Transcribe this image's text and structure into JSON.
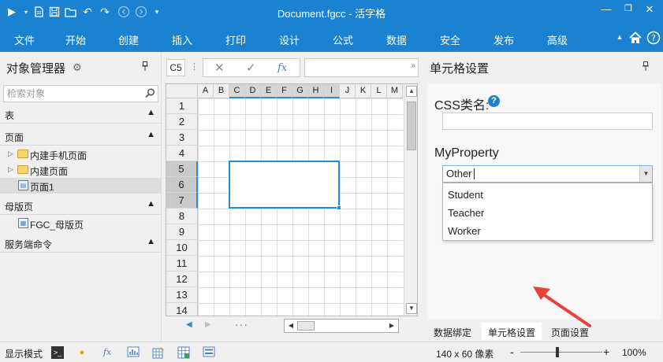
{
  "titlebar": {
    "title": "Document.fgcc - 活字格",
    "quick_access": [
      "play-icon",
      "dropdown-icon",
      "new-doc-icon",
      "save-icon",
      "open-folder-icon",
      "undo-icon",
      "redo-icon",
      "back-icon",
      "forward-icon",
      "customize-icon"
    ],
    "window_buttons": [
      "minimize-icon",
      "restore-icon",
      "close-icon"
    ]
  },
  "menubar": {
    "items": [
      "文件",
      "开始",
      "创建",
      "插入",
      "打印",
      "设计",
      "公式",
      "数据",
      "安全",
      "发布",
      "高级"
    ],
    "active": "开始"
  },
  "object_manager": {
    "title": "对象管理器",
    "search_placeholder": "检索对象",
    "sections": {
      "tables": "表",
      "pages": "页面",
      "master_pages": "母版页",
      "server_commands": "服务端命令"
    },
    "pages_tree": [
      {
        "label": "内建手机页面",
        "type": "folder"
      },
      {
        "label": "内建页面",
        "type": "folder"
      },
      {
        "label": "页面1",
        "type": "page",
        "selected": true
      }
    ],
    "master_tree": [
      {
        "label": "FGC_母版页",
        "type": "master"
      }
    ]
  },
  "formula_bar": {
    "cell_ref": "C5",
    "fx_label": "fx"
  },
  "grid": {
    "columns": [
      "A",
      "B",
      "C",
      "D",
      "E",
      "F",
      "G",
      "H",
      "I",
      "J",
      "K",
      "L",
      "M"
    ],
    "rows": [
      "1",
      "2",
      "3",
      "4",
      "5",
      "6",
      "7",
      "8",
      "9",
      "10",
      "11",
      "12",
      "13",
      "14"
    ],
    "highlight_columns": [
      "C",
      "D",
      "E",
      "F",
      "G",
      "H",
      "I"
    ],
    "highlight_rows": [
      "5",
      "6",
      "7"
    ]
  },
  "cell_settings": {
    "title": "单元格设置",
    "css_label": "CSS类名:",
    "css_value": "",
    "my_property_label": "MyProperty",
    "selected_value": "Other",
    "options": [
      "Student",
      "Teacher",
      "Worker"
    ],
    "tabs": [
      "数据绑定",
      "单元格设置",
      "页面设置"
    ],
    "active_tab": "单元格设置"
  },
  "statusbar": {
    "mode": "显示模式",
    "size": "140 x 60 像素",
    "zoom": "100%",
    "zoom_minus": "-",
    "zoom_plus": "+"
  },
  "colors": {
    "brand": "#1a82d0",
    "selection": "#2a8bd0",
    "annotation_arrow": "#e8413a"
  }
}
